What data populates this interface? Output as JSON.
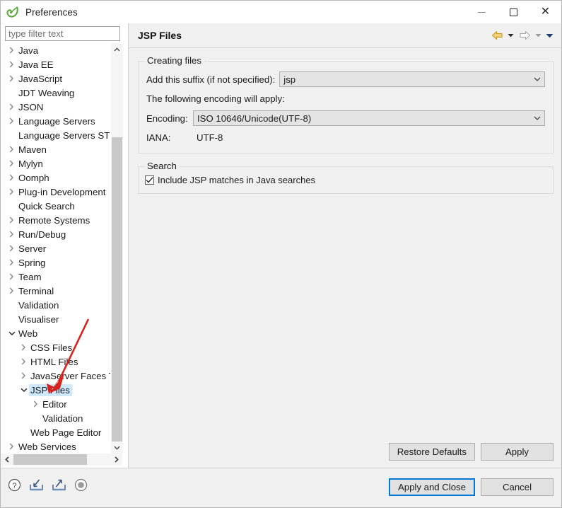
{
  "window": {
    "title": "Preferences",
    "app_icon": "spring-leaf-icon",
    "controls": {
      "minimize": "minimize-icon",
      "maximize": "maximize-icon",
      "close": "close-icon"
    }
  },
  "sidebar": {
    "filter": {
      "value": "",
      "placeholder": "type filter text"
    },
    "items": [
      {
        "label": "Java",
        "indent": 0,
        "twisty": "collapsed",
        "selected": false
      },
      {
        "label": "Java EE",
        "indent": 0,
        "twisty": "collapsed",
        "selected": false
      },
      {
        "label": "JavaScript",
        "indent": 0,
        "twisty": "collapsed",
        "selected": false
      },
      {
        "label": "JDT Weaving",
        "indent": 0,
        "twisty": "none",
        "selected": false
      },
      {
        "label": "JSON",
        "indent": 0,
        "twisty": "collapsed",
        "selected": false
      },
      {
        "label": "Language Servers",
        "indent": 0,
        "twisty": "collapsed",
        "selected": false
      },
      {
        "label": "Language Servers STS",
        "indent": 0,
        "twisty": "none",
        "selected": false
      },
      {
        "label": "Maven",
        "indent": 0,
        "twisty": "collapsed",
        "selected": false
      },
      {
        "label": "Mylyn",
        "indent": 0,
        "twisty": "collapsed",
        "selected": false
      },
      {
        "label": "Oomph",
        "indent": 0,
        "twisty": "collapsed",
        "selected": false
      },
      {
        "label": "Plug-in Development",
        "indent": 0,
        "twisty": "collapsed",
        "selected": false
      },
      {
        "label": "Quick Search",
        "indent": 0,
        "twisty": "none",
        "selected": false
      },
      {
        "label": "Remote Systems",
        "indent": 0,
        "twisty": "collapsed",
        "selected": false
      },
      {
        "label": "Run/Debug",
        "indent": 0,
        "twisty": "collapsed",
        "selected": false
      },
      {
        "label": "Server",
        "indent": 0,
        "twisty": "collapsed",
        "selected": false
      },
      {
        "label": "Spring",
        "indent": 0,
        "twisty": "collapsed",
        "selected": false
      },
      {
        "label": "Team",
        "indent": 0,
        "twisty": "collapsed",
        "selected": false
      },
      {
        "label": "Terminal",
        "indent": 0,
        "twisty": "collapsed",
        "selected": false
      },
      {
        "label": "Validation",
        "indent": 0,
        "twisty": "none",
        "selected": false
      },
      {
        "label": "Visualiser",
        "indent": 0,
        "twisty": "none",
        "selected": false
      },
      {
        "label": "Web",
        "indent": 0,
        "twisty": "expanded",
        "selected": false
      },
      {
        "label": "CSS Files",
        "indent": 1,
        "twisty": "collapsed",
        "selected": false
      },
      {
        "label": "HTML Files",
        "indent": 1,
        "twisty": "collapsed",
        "selected": false
      },
      {
        "label": "JavaServer Faces Tools",
        "indent": 1,
        "twisty": "collapsed",
        "selected": false
      },
      {
        "label": "JSP Files",
        "indent": 1,
        "twisty": "expanded",
        "selected": true
      },
      {
        "label": "Editor",
        "indent": 2,
        "twisty": "collapsed",
        "selected": false
      },
      {
        "label": "Validation",
        "indent": 2,
        "twisty": "none",
        "selected": false
      },
      {
        "label": "Web Page Editor",
        "indent": 1,
        "twisty": "none",
        "selected": false
      },
      {
        "label": "Web Services",
        "indent": 0,
        "twisty": "collapsed",
        "selected": false
      }
    ],
    "scroll": {
      "up_arrow": "chevron-up-icon",
      "down_arrow": "chevron-down-icon",
      "left_arrow": "chevron-left-icon",
      "right_arrow": "chevron-right-icon"
    }
  },
  "page": {
    "title": "JSP Files",
    "nav": {
      "back": "back-arrow-icon",
      "back_menu": "caret-down-icon",
      "forward": "forward-arrow-icon",
      "forward_menu": "caret-down-icon",
      "view_menu": "caret-down-icon"
    },
    "creating_files": {
      "legend": "Creating files",
      "suffix_label": "Add this suffix (if not specified):",
      "suffix_value": "jsp",
      "encoding_note": "The following encoding will apply:",
      "encoding_label": "Encoding:",
      "encoding_value": "ISO 10646/Unicode(UTF-8)",
      "iana_label": "IANA:",
      "iana_value": "UTF-8"
    },
    "search": {
      "legend": "Search",
      "checkbox_label": "Include JSP matches in Java searches",
      "checked": true
    },
    "buttons": {
      "restore_defaults": "Restore Defaults",
      "apply": "Apply"
    }
  },
  "bottom": {
    "icons": [
      {
        "name": "help-icon"
      },
      {
        "name": "import-icon"
      },
      {
        "name": "export-icon"
      },
      {
        "name": "record-icon"
      }
    ],
    "apply_and_close": "Apply and Close",
    "cancel": "Cancel"
  },
  "colors": {
    "selection": "#cde8ff",
    "focus_border": "#0078d7",
    "panel_bg": "#f0f0f0",
    "annotation_red": "#d8221c",
    "back_arrow": "#e8b33a"
  }
}
